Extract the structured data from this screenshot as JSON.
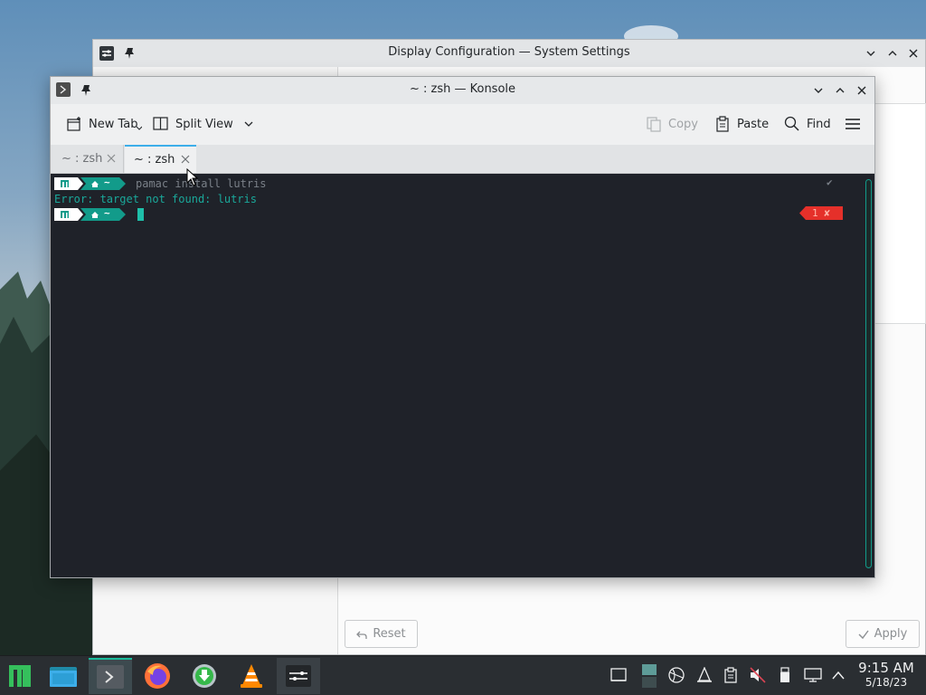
{
  "settings_window": {
    "title": "Display Configuration — System Settings",
    "reset_label": "Reset",
    "apply_label": "Apply"
  },
  "konsole": {
    "title": "~ : zsh — Konsole",
    "toolbar": {
      "new_tab": "New Tab",
      "split_view": "Split View",
      "copy": "Copy",
      "paste": "Paste",
      "find": "Find"
    },
    "tabs": [
      {
        "label": "~ : zsh",
        "active": false
      },
      {
        "label": "~ : zsh",
        "active": true
      }
    ],
    "terminal": {
      "prompt_home": "~",
      "command": "pamac install lutris",
      "command_status": "✔",
      "error_line": "Error: target not found: lutris",
      "exit_code": "1 ✘"
    }
  },
  "taskbar": {
    "apps": [
      "app-launcher",
      "dolphin-file-manager",
      "konsole",
      "firefox",
      "downloader",
      "vlc",
      "system-settings"
    ],
    "clock_time": "9:15 AM",
    "clock_date": "5/18/23"
  },
  "colors": {
    "terminal_bg": "#1f2229",
    "prompt_teal": "#129b8a",
    "error_red": "#e5302a",
    "accent": "#3daee9"
  }
}
